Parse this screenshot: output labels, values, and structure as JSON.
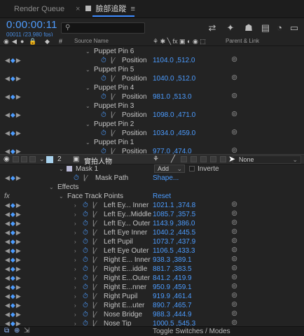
{
  "tabs": {
    "render_queue": "Render Queue",
    "comp_close": "×",
    "comp_name": "臉部追蹤",
    "comp_menu": "≡"
  },
  "header": {
    "timecode": "0:00:00:11",
    "frame_info": "00011 (23.980 fps)",
    "search_icon": "⚲",
    "search_placeholder": ""
  },
  "columns": {
    "source_name": "Source Name",
    "parent_link": "Parent & Link",
    "switch_glyphs": "⚘ ✱ ╲ fx ▣ ◐ ◉ ⬚"
  },
  "puppet_pins": [
    {
      "name": "Puppet Pin 6",
      "prop": "Position",
      "value": "1104.0 ,512.0"
    },
    {
      "name": "Puppet Pin 5",
      "prop": "Position",
      "value": "1040.0 ,512.0"
    },
    {
      "name": "Puppet Pin 4",
      "prop": "Position",
      "value": "981.0 ,513.0"
    },
    {
      "name": "Puppet Pin 3",
      "prop": "Position",
      "value": "1098.0 ,471.0"
    },
    {
      "name": "Puppet Pin 2",
      "prop": "Position",
      "value": "1034.0 ,459.0"
    },
    {
      "name": "Puppet Pin 1",
      "prop": "Position",
      "value": "977.0 ,474.0"
    }
  ],
  "layer": {
    "number": "2",
    "name": "實拍人物",
    "parent": "None"
  },
  "mask": {
    "name": "Mask 1",
    "mode": "Add",
    "inverted_label": "Inverte",
    "path_label": "Mask Path",
    "path_value": "Shape..."
  },
  "effects": {
    "label": "Effects",
    "fx_glyph": "fx",
    "effect_name": "Face Track Points",
    "reset": "Reset",
    "points": [
      {
        "name": "Left Ey... Inner",
        "value": "1021.1 ,374.8"
      },
      {
        "name": "Left Ey...Middle",
        "value": "1085.7 ,357.5"
      },
      {
        "name": "Left Ey... Outer",
        "value": "1143.9 ,386.0"
      },
      {
        "name": "Left Eye Inner",
        "value": "1040.2 ,445.5"
      },
      {
        "name": "Left Pupil",
        "value": "1073.7 ,437.9"
      },
      {
        "name": "Left Eye Outer",
        "value": "1106.5 ,433.3"
      },
      {
        "name": "Right E... Inner",
        "value": "938.3 ,389.1"
      },
      {
        "name": "Right E...iddle",
        "value": "881.7 ,383.5"
      },
      {
        "name": "Right E...Outer",
        "value": "841.2 ,419.9"
      },
      {
        "name": "Right E...nner",
        "value": "950.9 ,459.1"
      },
      {
        "name": "Right Pupil",
        "value": "919.9 ,461.4"
      },
      {
        "name": "Right E...uter",
        "value": "890.7 ,465.7"
      },
      {
        "name": "Nose Bridge",
        "value": "988.3 ,444.9"
      },
      {
        "name": "Nose Tip",
        "value": "1000.5 ,545.3"
      }
    ]
  },
  "footer": {
    "toggle_label": "Toggle Switches / Modes"
  },
  "colors": {
    "accent_blue": "#4c9cff",
    "background": "#232323",
    "layer_label": "#a9d3ee"
  }
}
